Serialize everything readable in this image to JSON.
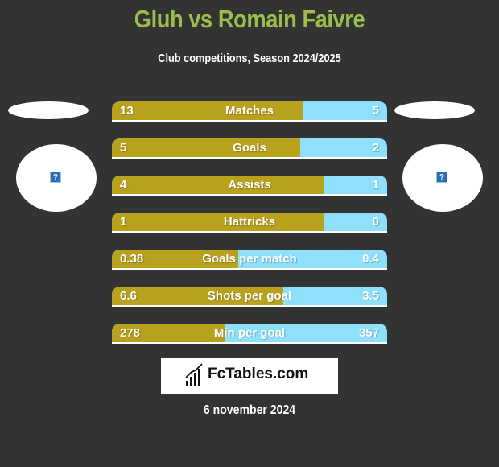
{
  "header": {
    "title": "Gluh vs Romain Faivre",
    "subtitle": "Club competitions, Season 2024/2025"
  },
  "players": {
    "left": {
      "name": "Gluh",
      "image": "missing-image-icon"
    },
    "right": {
      "name": "Romain Faivre",
      "image": "missing-image-icon"
    }
  },
  "colors": {
    "left_bar": "#b8a11d",
    "right_bar": "#8ee0fb",
    "title": "#9bbd4a",
    "background": "#333333"
  },
  "stats": [
    {
      "label": "Matches",
      "left": "13",
      "right": "5",
      "left_fill": 0.693
    },
    {
      "label": "Goals",
      "left": "5",
      "right": "2",
      "left_fill": 0.684
    },
    {
      "label": "Assists",
      "left": "4",
      "right": "1",
      "left_fill": 0.77
    },
    {
      "label": "Hattricks",
      "left": "1",
      "right": "0",
      "left_fill": 0.77
    },
    {
      "label": "Goals per match",
      "left": "0.38",
      "right": "0.4",
      "left_fill": 0.459
    },
    {
      "label": "Shots per goal",
      "left": "6.6",
      "right": "3.5",
      "left_fill": 0.623
    },
    {
      "label": "Min per goal",
      "left": "278",
      "right": "357",
      "left_fill": 0.412
    }
  ],
  "footer": {
    "logo_text": "FcTables.com",
    "date": "6 november 2024"
  }
}
